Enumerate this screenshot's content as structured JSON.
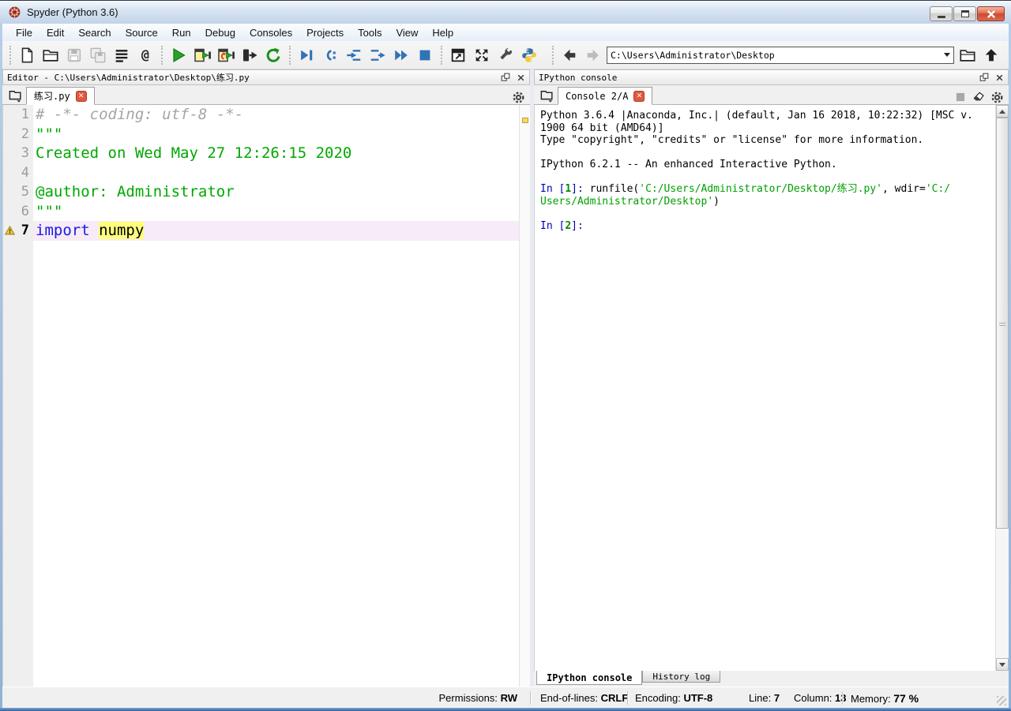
{
  "window": {
    "title": "Spyder (Python 3.6)"
  },
  "menu": {
    "items": [
      "File",
      "Edit",
      "Search",
      "Source",
      "Run",
      "Debug",
      "Consoles",
      "Projects",
      "Tools",
      "View",
      "Help"
    ]
  },
  "toolbar": {
    "path_value": "C:\\Users\\Administrator\\Desktop",
    "icons": [
      "new-file",
      "open-file",
      "save",
      "save-all",
      "file-switcher",
      "find-symbols",
      "run-file",
      "run-cell",
      "run-cell-advance",
      "run-selection",
      "rerun-cell",
      "debug-file",
      "run-current-line",
      "step-into",
      "step-return",
      "continue-execution",
      "stop-debug",
      "maximize-pane",
      "fullscreen",
      "preferences",
      "python-path-manager",
      "back",
      "forward",
      "open-directory",
      "parent-directory"
    ]
  },
  "editor": {
    "pane_title": "Editor - C:\\Users\\Administrator\\Desktop\\练习.py",
    "tab": "练习.py",
    "lines": [
      {
        "num": 1,
        "segments": [
          {
            "t": "# -*- coding: utf-8 -*-",
            "c": "comment"
          }
        ]
      },
      {
        "num": 2,
        "segments": [
          {
            "t": "\"\"\"",
            "c": "string"
          }
        ]
      },
      {
        "num": 3,
        "segments": [
          {
            "t": "Created on Wed May 27 12:26:15 2020",
            "c": "string"
          }
        ]
      },
      {
        "num": 4,
        "segments": []
      },
      {
        "num": 5,
        "segments": [
          {
            "t": "@author: Administrator",
            "c": "string"
          }
        ]
      },
      {
        "num": 6,
        "segments": [
          {
            "t": "\"\"\"",
            "c": "string"
          }
        ]
      },
      {
        "num": 7,
        "current": true,
        "warning": true,
        "segments": [
          {
            "t": "import ",
            "c": "kw"
          },
          {
            "t": "numpy",
            "c": "occ"
          }
        ]
      }
    ]
  },
  "console": {
    "pane_title": "IPython console",
    "tab": "Console 2/A",
    "bottom_tabs": [
      "IPython console",
      "History log"
    ],
    "lines": [
      [
        {
          "t": "Python 3.6.4 |Anaconda, Inc.| (default, Jan 16 2018, 10:22:32) [MSC v.",
          "c": "p"
        }
      ],
      [
        {
          "t": "1900 64 bit (AMD64)]",
          "c": "p"
        }
      ],
      [
        {
          "t": "Type \"copyright\", \"credits\" or \"license\" for more information.",
          "c": "p"
        }
      ],
      [],
      [
        {
          "t": "IPython 6.2.1 -- An enhanced Interactive Python.",
          "c": "p"
        }
      ],
      [],
      [
        {
          "t": "In [",
          "c": "pr"
        },
        {
          "t": "1",
          "c": "pn"
        },
        {
          "t": "]: ",
          "c": "pr"
        },
        {
          "t": "runfile(",
          "c": "p"
        },
        {
          "t": "'C:/Users/Administrator/Desktop/练习.py'",
          "c": "s"
        },
        {
          "t": ", wdir=",
          "c": "p"
        },
        {
          "t": "'C:/",
          "c": "s"
        }
      ],
      [
        {
          "t": "Users/Administrator/Desktop'",
          "c": "s"
        },
        {
          "t": ")",
          "c": "p"
        }
      ],
      [],
      [
        {
          "t": "In [",
          "c": "pr"
        },
        {
          "t": "2",
          "c": "pn"
        },
        {
          "t": "]: ",
          "c": "pr"
        }
      ]
    ]
  },
  "statusbar": {
    "permissions_label": "Permissions:",
    "permissions": "RW",
    "eol_label": "End-of-lines:",
    "eol": "CRLF",
    "encoding_label": "Encoding:",
    "encoding": "UTF-8",
    "line_label": "Line:",
    "line": "7",
    "column_label": "Column:",
    "column": "13",
    "memory_label": "Memory:",
    "memory": "77 %"
  },
  "colors": {
    "keyword": "#1a1ae6",
    "string": "#00a800",
    "comment": "#a5a5a5",
    "occurrence_bg": "#ffff7d",
    "current_line_bg": "#f6ebf7",
    "prompt": "#0000b7",
    "prompt_number": "#008a00",
    "console_string": "#00a000",
    "run_green": "#27a325",
    "debug_blue": "#2f74b5",
    "tab_close_red": "#e0593f"
  }
}
